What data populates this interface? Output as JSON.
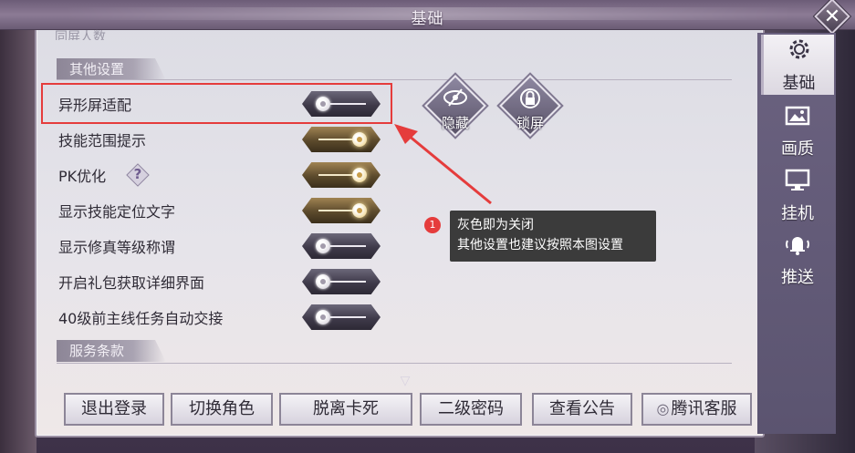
{
  "window": {
    "title": "基础"
  },
  "scroll_hint": "同屏人数",
  "sections": {
    "other_settings": "其他设置",
    "service_terms": "服务条款"
  },
  "settings": [
    {
      "label": "异形屏适配",
      "state": "off"
    },
    {
      "label": "技能范围提示",
      "state": "on"
    },
    {
      "label": "PK优化",
      "state": "on",
      "help": "?"
    },
    {
      "label": "显示技能定位文字",
      "state": "on"
    },
    {
      "label": "显示修真等级称谓",
      "state": "off"
    },
    {
      "label": "开启礼包获取详细界面",
      "state": "off"
    },
    {
      "label": "40级前主线任务自动交接",
      "state": "off"
    }
  ],
  "icon_buttons": {
    "hide": {
      "label": "隐藏",
      "icon": "eye-slash-icon"
    },
    "lock": {
      "label": "锁屏",
      "icon": "lock-icon"
    }
  },
  "annotation": {
    "number": "1",
    "line1": "灰色即为关闭",
    "line2": "其他设置也建议按照本图设置",
    "color": "#e53c3c"
  },
  "tabs": [
    {
      "label": "基础",
      "icon": "gear-icon",
      "active": true
    },
    {
      "label": "画质",
      "icon": "image-icon",
      "active": false
    },
    {
      "label": "挂机",
      "icon": "monitor-icon",
      "active": false
    },
    {
      "label": "推送",
      "icon": "bell-icon",
      "active": false
    }
  ],
  "bottom_buttons": {
    "logout": "退出登录",
    "switch_role": "切换角色",
    "unstuck": "脱离卡死",
    "secondary_password": "二级密码",
    "announcement": "查看公告",
    "customer_service": "腾讯客服"
  }
}
